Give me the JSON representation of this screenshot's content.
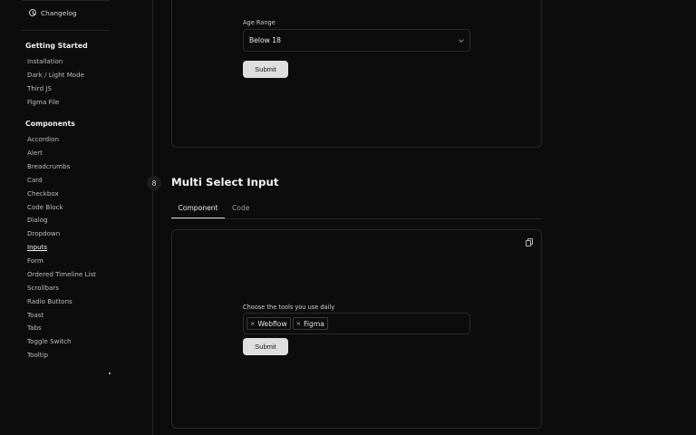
{
  "sidebar": {
    "changelog": "Changelog",
    "sections": [
      {
        "heading": "Getting Started",
        "items": [
          "Installation",
          "Dark / Light Mode",
          "Third JS",
          "Figma File"
        ]
      },
      {
        "heading": "Components",
        "items": [
          "Accordion",
          "Alert",
          "Breadcrumbs",
          "Card",
          "Checkbox",
          "Code Block",
          "Dialog",
          "Dropdown",
          "Inputs",
          "Form",
          "Ordered Timeline List",
          "Scrollbars",
          "Radio Buttons",
          "Toast",
          "Tabs",
          "Toggle Switch",
          "Tooltip"
        ]
      }
    ],
    "active_item": "Inputs"
  },
  "top_example": {
    "label": "Age Range",
    "select_value": "Below 18",
    "submit_label": "Submit"
  },
  "section": {
    "step": "8",
    "title": "Multi Select Input",
    "tabs": [
      {
        "label": "Component",
        "active": true
      },
      {
        "label": "Code",
        "active": false
      }
    ]
  },
  "bottom_example": {
    "label": "Choose the tools you use daily",
    "tags": [
      {
        "remove": "×",
        "label": "Webflow"
      },
      {
        "remove": "×",
        "label": "Figma"
      }
    ],
    "submit_label": "Submit"
  },
  "icons": {
    "changelog": "clock-icon",
    "select": "chevron-down-icon",
    "copy": "copy-icon"
  },
  "colors": {
    "background": "#0c0c0c",
    "border": "#272727",
    "button": "#dedede"
  }
}
